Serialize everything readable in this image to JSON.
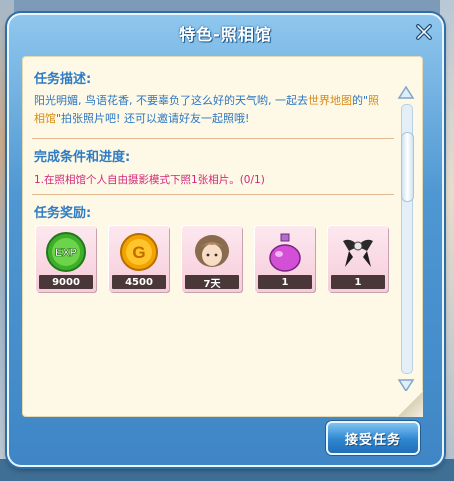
{
  "window": {
    "title": "特色-照相馆"
  },
  "description": {
    "heading": "任务描述:",
    "text_part1": "阳光明媚, 鸟语花香, 不要辜负了这么好的天气哟, 一起去",
    "highlight1": "世界地图",
    "text_part2": "的\"",
    "highlight2": "照相馆",
    "text_part3": "\"拍张照片吧! 还可以邀请好友一起照哦!"
  },
  "conditions": {
    "heading": "完成条件和进度:",
    "text": "1.在照相馆个人自由摄影模式下照1张相片。(0/1)"
  },
  "rewards": {
    "heading": "任务奖励:",
    "items": [
      {
        "icon": "exp-icon",
        "count": "9000"
      },
      {
        "icon": "gold-coin-icon",
        "count": "4500"
      },
      {
        "icon": "hairstyle-icon",
        "count": "7天"
      },
      {
        "icon": "potion-bottle-icon",
        "count": "1"
      },
      {
        "icon": "bow-accessory-icon",
        "count": "1"
      }
    ]
  },
  "buttons": {
    "accept_label": "接受任务"
  },
  "colors": {
    "accent": "#2f7cc4",
    "highlight": "#d68a18",
    "condition": "#d2287a"
  }
}
